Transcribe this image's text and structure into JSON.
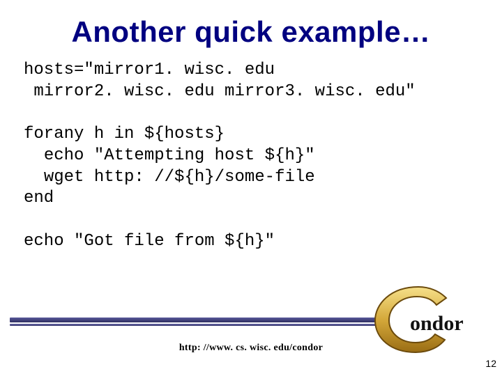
{
  "title": "Another quick example…",
  "code": {
    "l1": "hosts=\"mirror1. wisc. edu",
    "l2": " mirror2. wisc. edu mirror3. wisc. edu\"",
    "l3": "",
    "l4": "forany h in ${hosts}",
    "l5": "  echo \"Attempting host ${h}\"",
    "l6": "  wget http: //${h}/some-file",
    "l7": "end",
    "l8": "",
    "l9": "echo \"Got file from ${h}\""
  },
  "footer_url": "http: //www. cs. wisc. edu/condor",
  "page_number": "12",
  "logo_text": "ondor",
  "colors": {
    "title": "#000080",
    "rule": "#34346a"
  }
}
